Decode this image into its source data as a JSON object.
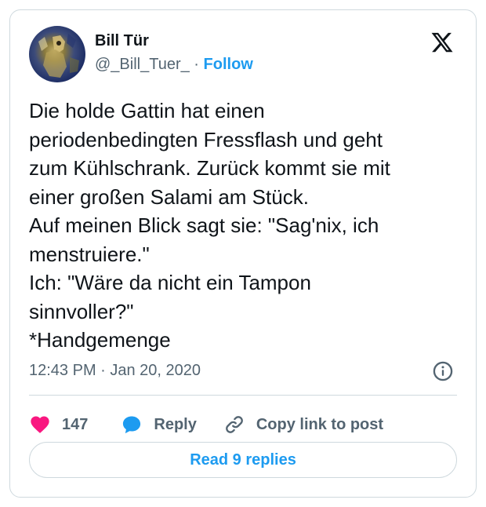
{
  "user": {
    "name": "Bill Tür",
    "handle": "@_Bill_Tuer_",
    "separator": "·",
    "follow": "Follow"
  },
  "brand_icon": "x-logo-icon",
  "tweet": {
    "text": "Die holde Gattin hat einen\nperiodenbedingten Fressflash und geht\nzum Kühlschrank. Zurück kommt sie mit\neiner großen Salami am Stück.\nAuf meinen Blick sagt sie: \"Sag'nix, ich\nmenstruiere.\"\nIch: \"Wäre da nicht ein Tampon\nsinnvoller?\"\n*Handgemenge",
    "timestamp": "12:43 PM · Jan 20, 2020"
  },
  "actions": {
    "like_count": "147",
    "reply": "Reply",
    "copy_link": "Copy link to post"
  },
  "read_replies": "Read 9 replies",
  "colors": {
    "accent": "#1d9bf0",
    "like": "#f91880",
    "muted": "#536471",
    "text": "#0f1419",
    "border": "#cfd9de"
  }
}
